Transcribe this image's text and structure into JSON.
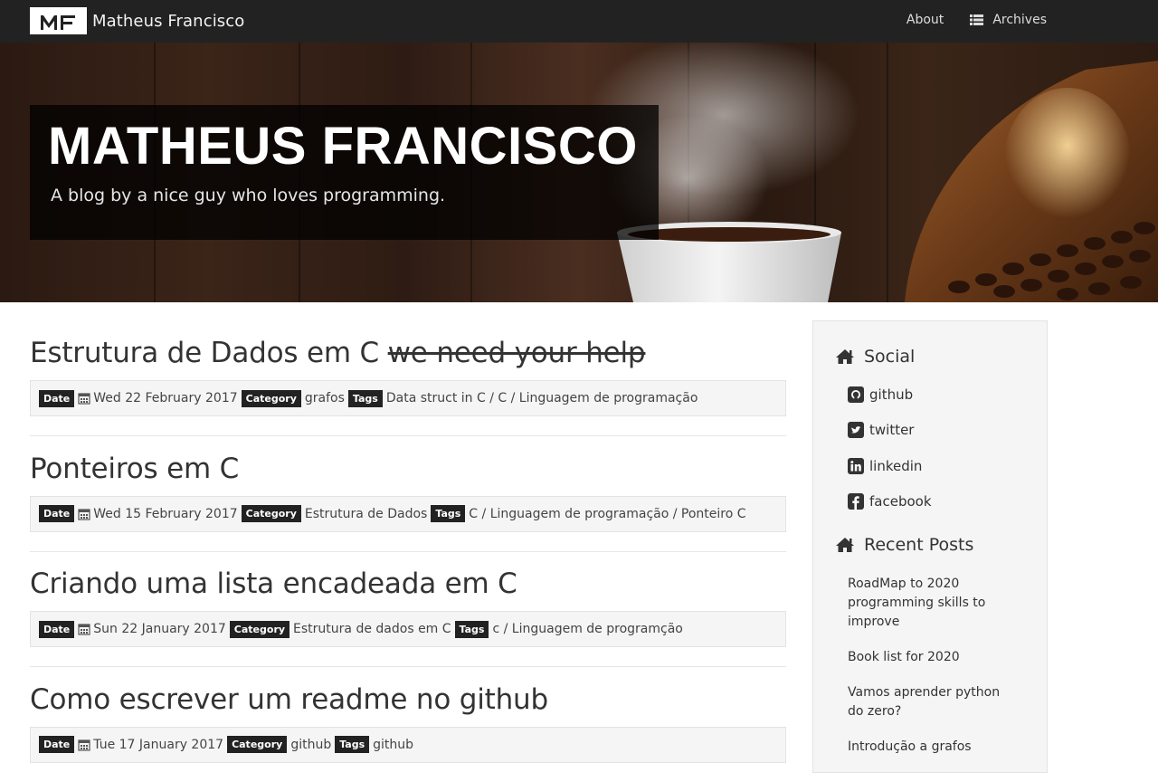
{
  "navbar": {
    "brand_logo_text": "MF",
    "brand_name": "Matheus Francisco",
    "links": [
      {
        "label": "About",
        "icon": ""
      },
      {
        "label": "Archives",
        "icon": "list-icon"
      }
    ]
  },
  "hero": {
    "title": "MATHEUS FRANCISCO",
    "subtitle": "A blog by a nice guy who loves programming."
  },
  "posts": [
    {
      "title": "Estrutura de Dados em C",
      "title_strike": "we need your help",
      "date_label": "Date",
      "date": "Wed 22 February 2017",
      "category_label": "Category",
      "category": "grafos",
      "tags_label": "Tags",
      "tags": "Data struct in C / C / Linguagem de programação"
    },
    {
      "title": "Ponteiros em C",
      "title_strike": "",
      "date_label": "Date",
      "date": "Wed 15 February 2017",
      "category_label": "Category",
      "category": "Estrutura de Dados",
      "tags_label": "Tags",
      "tags": "C / Linguagem de programação / Ponteiro C"
    },
    {
      "title": "Criando uma lista encadeada em C",
      "title_strike": "",
      "date_label": "Date",
      "date": "Sun 22 January 2017",
      "category_label": "Category",
      "category": "Estrutura de dados em C",
      "tags_label": "Tags",
      "tags": "c / Linguagem de programção"
    },
    {
      "title": "Como escrever um readme no github",
      "title_strike": "",
      "date_label": "Date",
      "date": "Tue 17 January 2017",
      "category_label": "Category",
      "category": "github",
      "tags_label": "Tags",
      "tags": "github"
    }
  ],
  "sidebar": {
    "social_heading": "Social",
    "social": [
      {
        "label": "github",
        "icon": "github-icon"
      },
      {
        "label": "twitter",
        "icon": "twitter-icon"
      },
      {
        "label": "linkedin",
        "icon": "linkedin-icon"
      },
      {
        "label": "facebook",
        "icon": "facebook-icon"
      }
    ],
    "recent_heading": "Recent Posts",
    "recent": [
      "RoadMap to 2020 programming skills to improve",
      "Book list for 2020",
      "Vamos aprender python do zero?",
      "Introdução a grafos"
    ]
  },
  "colors": {
    "navbar_bg": "#222222",
    "label_bg": "#222222",
    "meta_bg": "#f5f5f5",
    "hero_overlay": "rgba(0,0,0,0.75)"
  }
}
